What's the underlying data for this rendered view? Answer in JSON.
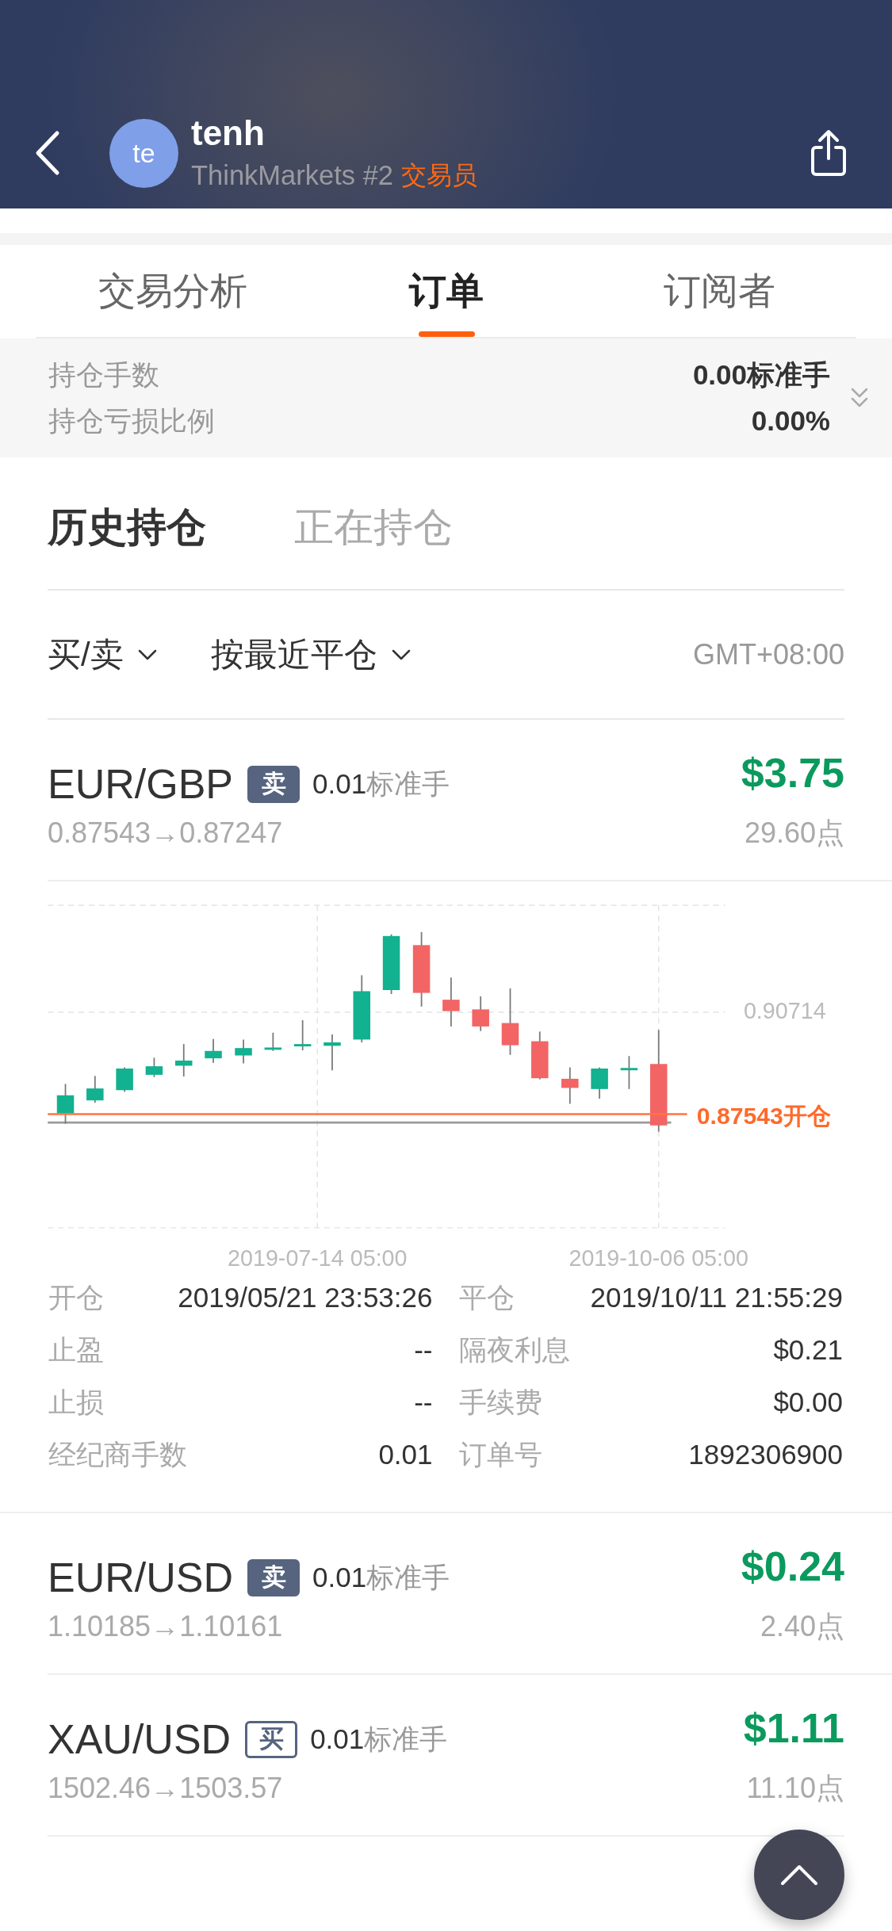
{
  "profile": {
    "avatar_text": "te",
    "name": "tenh",
    "broker": "ThinkMarkets #2",
    "role": "交易员"
  },
  "tabs": [
    {
      "label": "交易分析",
      "selected": false
    },
    {
      "label": "订单",
      "selected": true
    },
    {
      "label": "订阅者",
      "selected": false
    }
  ],
  "position_summary": [
    {
      "label": "持仓手数",
      "value": "0.00标准手"
    },
    {
      "label": "持仓亏损比例",
      "value": "0.00%"
    }
  ],
  "sub_tabs": [
    {
      "label": "历史持仓",
      "selected": true
    },
    {
      "label": "正在持仓",
      "selected": false
    }
  ],
  "filters": [
    {
      "label": "买/卖"
    },
    {
      "label": "按最近平仓"
    }
  ],
  "timezone": "GMT+08:00",
  "orders": [
    {
      "symbol": "EUR/GBP",
      "badge": {
        "text": "卖",
        "filled": true
      },
      "lots": "0.01",
      "lot_unit": "标准手",
      "profit": "$3.75",
      "price_change": "0.87543→0.87247",
      "points": "29.60点",
      "chart": {
        "price_label": "0.90714",
        "open_label": "0.87543开仓",
        "time_labels": [
          "2019-07-14 05:00",
          "2019-10-06 05:00"
        ]
      },
      "details": [
        {
          "label": "开仓",
          "value": "2019/05/21 23:53:26"
        },
        {
          "label": "平仓",
          "value": "2019/10/11 21:55:29"
        },
        {
          "label": "止盈",
          "value": "--"
        },
        {
          "label": "隔夜利息",
          "value": "$0.21"
        },
        {
          "label": "止损",
          "value": "--"
        },
        {
          "label": "手续费",
          "value": "$0.00"
        },
        {
          "label": "经纪商手数",
          "value": "0.01"
        },
        {
          "label": "订单号",
          "value": "1892306900"
        }
      ]
    },
    {
      "symbol": "EUR/USD",
      "badge": {
        "text": "卖",
        "filled": true
      },
      "lots": "0.01",
      "lot_unit": "标准手",
      "profit": "$0.24",
      "price_change": "1.10185→1.10161",
      "points": "2.40点"
    },
    {
      "symbol": "XAU/USD",
      "badge": {
        "text": "买",
        "filled": false
      },
      "lots": "0.01",
      "lot_unit": "标准手",
      "profit": "$1.11",
      "price_change": "1502.46→1503.57",
      "points": "11.10点"
    }
  ]
}
